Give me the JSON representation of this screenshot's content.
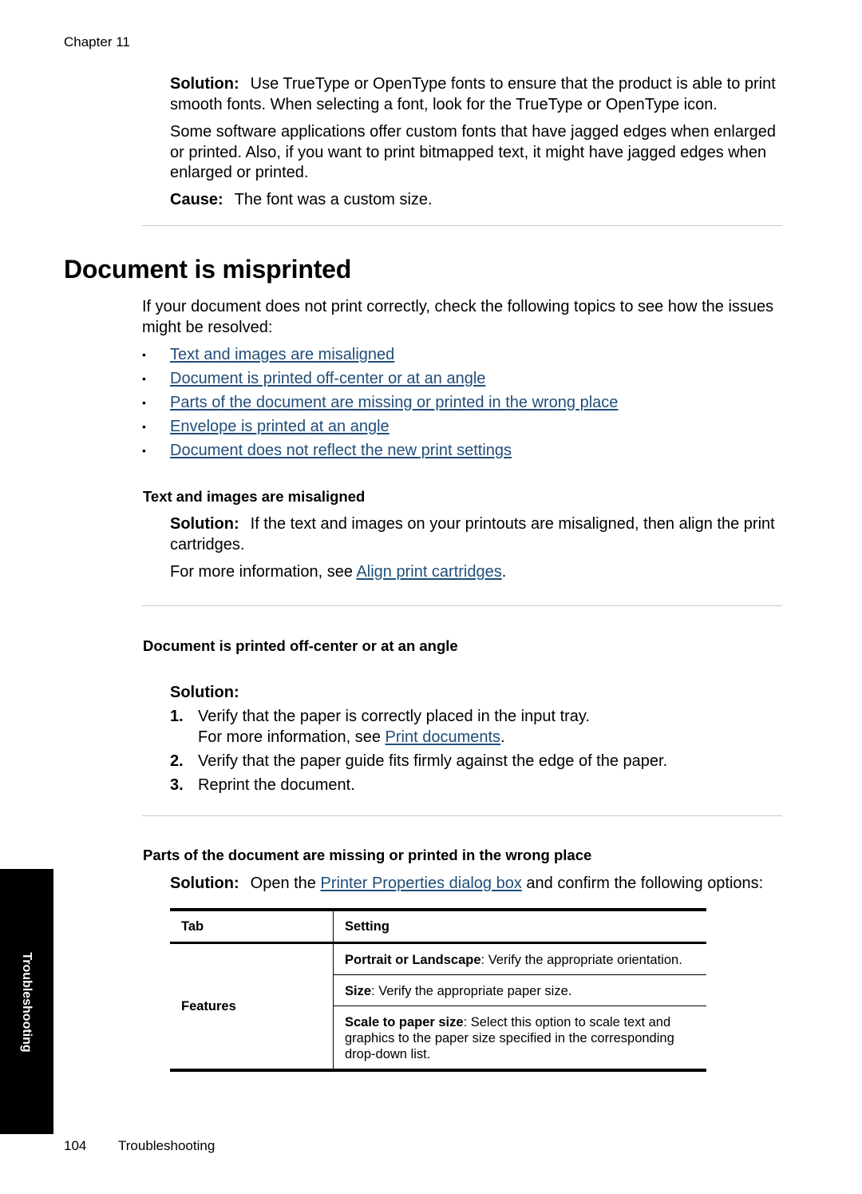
{
  "header": {
    "chapter": "Chapter 11"
  },
  "prev_section": {
    "solution_label": "Solution:",
    "solution_text": "Use TrueType or OpenType fonts to ensure that the product is able to print smooth fonts. When selecting a font, look for the TrueType or OpenType icon.",
    "note": "Some software applications offer custom fonts that have jagged edges when enlarged or printed. Also, if you want to print bitmapped text, it might have jagged edges when enlarged or printed.",
    "cause_label": "Cause:",
    "cause_text": "The font was a custom size."
  },
  "section": {
    "title": "Document is misprinted",
    "intro": "If your document does not print correctly, check the following topics to see how the issues might be resolved:",
    "topics": [
      "Text and images are misaligned",
      "Document is printed off-center or at an angle",
      "Parts of the document are missing or printed in the wrong place",
      "Envelope is printed at an angle",
      "Document does not reflect the new print settings"
    ]
  },
  "misaligned": {
    "heading": "Text and images are misaligned",
    "solution_label": "Solution:",
    "solution_text": "If the text and images on your printouts are misaligned, then align the print cartridges.",
    "more_info_prefix": "For more information, see ",
    "more_info_link": "Align print cartridges",
    "more_info_suffix": "."
  },
  "offcenter": {
    "heading": "Document is printed off-center or at an angle",
    "solution_label": "Solution:",
    "steps": [
      {
        "num": "1.",
        "text": "Verify that the paper is correctly placed in the input tray.",
        "sub_prefix": "For more information, see ",
        "sub_link": "Print documents",
        "sub_suffix": "."
      },
      {
        "num": "2.",
        "text": "Verify that the paper guide fits firmly against the edge of the paper."
      },
      {
        "num": "3.",
        "text": "Reprint the document."
      }
    ]
  },
  "missing": {
    "heading": "Parts of the document are missing or printed in the wrong place",
    "solution_label": "Solution:",
    "solution_prefix": "Open the ",
    "solution_link": "Printer Properties dialog box",
    "solution_suffix": " and confirm the following options:",
    "table": {
      "headers": [
        "Tab",
        "Setting"
      ],
      "tab_value": "Features",
      "rows": [
        {
          "term": "Portrait or Landscape",
          "desc": ": Verify the appropriate orientation."
        },
        {
          "term": "Size",
          "desc": ": Verify the appropriate paper size."
        },
        {
          "term": "Scale to paper size",
          "desc": ": Select this option to scale text and graphics to the paper size specified in the corresponding drop-down list."
        }
      ]
    }
  },
  "side_tab": {
    "label": "Troubleshooting"
  },
  "footer": {
    "page_number": "104",
    "section": "Troubleshooting"
  },
  "colors": {
    "link": "#1f4e79",
    "rule": "#c8c8c8",
    "tab_bg": "#000000"
  }
}
